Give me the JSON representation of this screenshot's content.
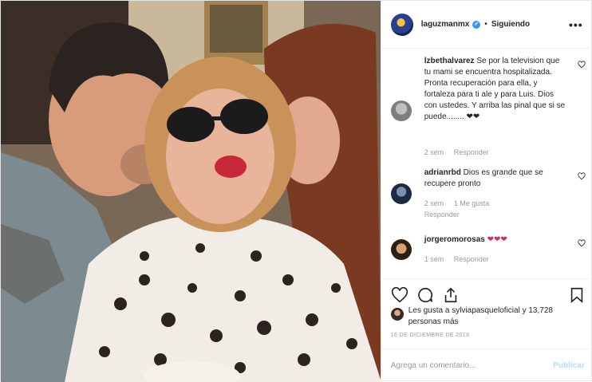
{
  "post": {
    "username": "laguzmanmx",
    "separator": "•",
    "follow_status": "Siguiendo",
    "more_glyph": "•••",
    "verified_glyph": "✔"
  },
  "comments": [
    {
      "user": "lzbethalvarez",
      "text": "Se por la television que tu mami se encuentra hospitalizada. Pronta recuperación para ella, y fortaleza para ti ale y para Luis. Dios con ustedes. Y arriba las pinal que si se puede........ ❤❤",
      "time": "2 sem",
      "reply": "Responder",
      "likes": ""
    },
    {
      "user": "adrianrbd",
      "text": "Dios es grande que se recupere pronto",
      "time": "2 sem",
      "likes": "1 Me gusta",
      "reply": "Responder"
    },
    {
      "user": "jorgeromorosas",
      "text": "❤❤❤",
      "time": "1 sem",
      "reply": "Responder",
      "likes": ""
    }
  ],
  "likes": {
    "text": "Les gusta a sylviapasqueloficial y 13,728 personas más"
  },
  "date": "16 DE DICIEMBRE DE 2018",
  "add_comment": {
    "placeholder": "Agrega un comentario...",
    "post_label": "Publicar"
  },
  "colors": {
    "link_blue": "#3897f0",
    "muted": "#999999",
    "text": "#262626"
  }
}
